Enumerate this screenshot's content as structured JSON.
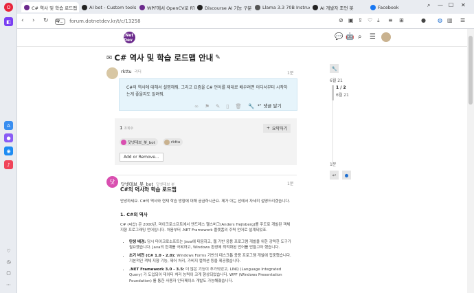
{
  "browser": {
    "tabs": [
      {
        "title": "C# 역사 및 학습 로드맵",
        "active": true,
        "fav_color": "#6b2a8c"
      },
      {
        "title": "AI bot - Custom tools -",
        "active": false,
        "fav_color": "#222"
      },
      {
        "title": "WPF에서 OpenCV로 RT",
        "active": false,
        "fav_color": "#6b2a8c"
      },
      {
        "title": "Discourse AI 기능 구분",
        "active": false,
        "fav_color": "#222"
      },
      {
        "title": "Llama 3.3 70B Instruct",
        "active": false,
        "fav_color": "#555"
      },
      {
        "title": "AI 개발자 조언 봇",
        "active": false,
        "fav_color": "#222"
      },
      {
        "title": "Facebook",
        "active": false,
        "fav_color": "#1877f2"
      }
    ],
    "url": "forum.dotnetdev.kr/t/c/13258",
    "url_prefix": "V..."
  },
  "forum": {
    "logo_text": ".Net Dev",
    "topic_title": "C# 역사 및 학습 로드맵 안내"
  },
  "post1": {
    "author": "rkttu",
    "role": "리더",
    "time": "1분",
    "body": "C#의 역사에 대해서 설명해줘. 그리고 요즘을 C# 언어를 제대로 배우려면 어디서부터 시작하는게 좋을지도 알려줘.",
    "reply_label": "댓글 달기"
  },
  "summary": {
    "count": "1",
    "count_label": "조회수",
    "summarize_label": "요약하기",
    "participants": [
      "닷넷데브_봇_bot",
      "rkttu"
    ],
    "add_remove_label": "Add or Remove..."
  },
  "post2": {
    "author": "닷넷데브_봇_bot",
    "role": "닷넷데브 봇",
    "time": "1분",
    "heading": "C#의 역사와 학습 로드맵",
    "intro": "안녕하세요. C#의 역사와 현재 학습 방향에 대해 궁금하시군요. 제가 아는 선에서 자세히 설명드리겠습니다.",
    "section1": "1. C#의 역사",
    "section1_text": "C# (씨샵) 은 2000년, 마이크로소프트에서 앤드레스 헬스버그(Anders Hejlsberg)를 주도로 개발된 객체 지향 프로그래밍 언어입니다. 처음부터 .NET Framework 플랫폼의 주력 언어로 설계되었죠.",
    "bullets": [
      {
        "bold": "탄생 배경:",
        "text": " 당시 마이크로소프트는 Java에 대응하고, 웹 기반 응용 프로그램 개발을 위한 강력한 도구가 필요했습니다. Java의 한계를 극복하고, Windows 환경에 최적화된 언어를 만들고자 했습니다."
      },
      {
        "bold": "초기 버전 (C# 1.0 - 2.0):",
        "text": " Windows Forms 기반의 데스크톱 응용 프로그램 개발에 집중했습니다. 기본적인 객체 지향 기능, 제어 처리, 가비지 컬렉션 등을 제공했습니다."
      },
      {
        "bold": ".NET Framework 3.0 - 3.5:",
        "text": " 더 많은 기능이 추가되었고, LINQ (Language Integrated Query) 가 도입되어 데이터 처리 능력이 크게 향상되었습니다. WPF (Windows Presentation Foundation) 를 통한 사용자 인터페이스 개발도 가능해졌습니다."
      }
    ]
  },
  "timeline": {
    "top_date": "6월 21",
    "position": "1 / 2",
    "position_date": "6월 21",
    "bottom_time": "1분"
  }
}
